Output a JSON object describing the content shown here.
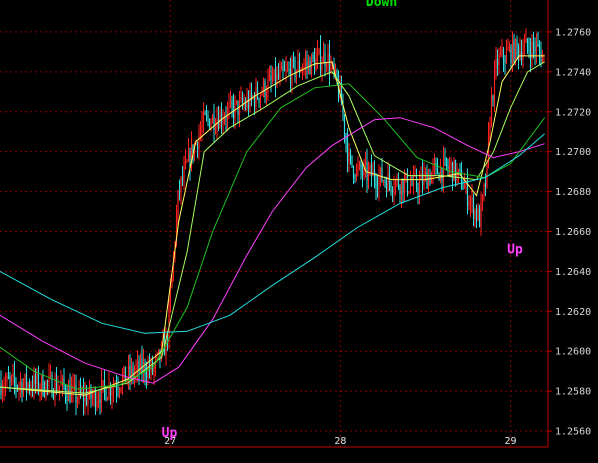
{
  "chart_data": {
    "type": "candlestick",
    "title": "",
    "xlabel": "",
    "ylabel": "",
    "ylim": [
      1.2552,
      1.2776
    ],
    "y_ticks": [
      "1.2560",
      "1.2580",
      "1.2600",
      "1.2620",
      "1.2640",
      "1.2660",
      "1.2680",
      "1.2700",
      "1.2720",
      "1.2740",
      "1.2760"
    ],
    "x_ticks": [
      "27",
      "28",
      "29"
    ],
    "grid": true,
    "colors": {
      "background": "#000000",
      "grid": "#8b0000",
      "axis": "#c00000",
      "up_candle": "#ff2020",
      "down_candle": "#30e0e0",
      "ma_fast": "#ffff60",
      "ma_mid": "#a8ff60",
      "ma_slow": "#20c020",
      "ma_long": "#ff40ff",
      "ma_longest": "#20e0e0",
      "signal_down": "#00e000",
      "signal_up": "#ff40ff"
    },
    "annotations": [
      {
        "text": "Down",
        "at": 28.15,
        "value": 1.2773,
        "color": "#00e000"
      },
      {
        "text": "Up",
        "at": 26.95,
        "value": 1.2557,
        "color": "#ff40ff"
      },
      {
        "text": "Up",
        "at": 28.98,
        "value": 1.2649,
        "color": "#ff40ff"
      }
    ],
    "price_path": [
      [
        26.0,
        1.2584
      ],
      [
        26.35,
        1.2583
      ],
      [
        26.45,
        1.2577
      ],
      [
        26.55,
        1.2577
      ],
      [
        26.7,
        1.2585
      ],
      [
        26.85,
        1.2592
      ],
      [
        26.9,
        1.259
      ],
      [
        26.98,
        1.2605
      ],
      [
        27.05,
        1.268
      ],
      [
        27.12,
        1.2698
      ],
      [
        27.2,
        1.2715
      ],
      [
        27.3,
        1.2718
      ],
      [
        27.45,
        1.2724
      ],
      [
        27.6,
        1.2735
      ],
      [
        27.75,
        1.2742
      ],
      [
        27.85,
        1.2745
      ],
      [
        27.92,
        1.2748
      ],
      [
        28.0,
        1.2728
      ],
      [
        28.05,
        1.2695
      ],
      [
        28.1,
        1.269
      ],
      [
        28.2,
        1.2688
      ],
      [
        28.3,
        1.2685
      ],
      [
        28.45,
        1.2683
      ],
      [
        28.55,
        1.269
      ],
      [
        28.65,
        1.2692
      ],
      [
        28.72,
        1.2684
      ],
      [
        28.78,
        1.2672
      ],
      [
        28.82,
        1.2666
      ],
      [
        28.86,
        1.2688
      ],
      [
        28.88,
        1.272
      ],
      [
        28.92,
        1.2745
      ],
      [
        29.0,
        1.275
      ],
      [
        29.08,
        1.2752
      ],
      [
        29.15,
        1.2752
      ],
      [
        29.2,
        1.2746
      ]
    ],
    "series": [
      {
        "key": "ma_fast",
        "points": [
          [
            26.0,
            1.2582
          ],
          [
            26.5,
            1.2578
          ],
          [
            26.75,
            1.2586
          ],
          [
            26.95,
            1.26
          ],
          [
            27.05,
            1.2665
          ],
          [
            27.15,
            1.2705
          ],
          [
            27.3,
            1.2716
          ],
          [
            27.5,
            1.2728
          ],
          [
            27.7,
            1.2738
          ],
          [
            27.85,
            1.2744
          ],
          [
            27.95,
            1.2745
          ],
          [
            28.05,
            1.2712
          ],
          [
            28.15,
            1.269
          ],
          [
            28.3,
            1.2686
          ],
          [
            28.5,
            1.2686
          ],
          [
            28.7,
            1.2689
          ],
          [
            28.8,
            1.2678
          ],
          [
            28.88,
            1.2705
          ],
          [
            28.95,
            1.2735
          ],
          [
            29.05,
            1.2748
          ],
          [
            29.2,
            1.2748
          ]
        ]
      },
      {
        "key": "ma_mid",
        "points": [
          [
            26.0,
            1.2582
          ],
          [
            26.5,
            1.2579
          ],
          [
            26.75,
            1.2584
          ],
          [
            26.95,
            1.2597
          ],
          [
            27.1,
            1.265
          ],
          [
            27.2,
            1.27
          ],
          [
            27.35,
            1.2712
          ],
          [
            27.55,
            1.2722
          ],
          [
            27.75,
            1.2733
          ],
          [
            27.95,
            1.274
          ],
          [
            28.05,
            1.2728
          ],
          [
            28.2,
            1.2698
          ],
          [
            28.4,
            1.2688
          ],
          [
            28.6,
            1.2688
          ],
          [
            28.8,
            1.2686
          ],
          [
            28.9,
            1.27
          ],
          [
            29.0,
            1.2722
          ],
          [
            29.1,
            1.274
          ],
          [
            29.2,
            1.2745
          ]
        ]
      },
      {
        "key": "ma_slow",
        "points": [
          [
            26.0,
            1.2602
          ],
          [
            26.2,
            1.259
          ],
          [
            26.45,
            1.2581
          ],
          [
            26.7,
            1.2583
          ],
          [
            26.9,
            1.2592
          ],
          [
            27.1,
            1.2622
          ],
          [
            27.25,
            1.266
          ],
          [
            27.45,
            1.27
          ],
          [
            27.65,
            1.2722
          ],
          [
            27.85,
            1.2732
          ],
          [
            28.05,
            1.2734
          ],
          [
            28.25,
            1.2717
          ],
          [
            28.45,
            1.2697
          ],
          [
            28.65,
            1.269
          ],
          [
            28.85,
            1.2687
          ],
          [
            29.0,
            1.2694
          ],
          [
            29.2,
            1.2717
          ]
        ]
      },
      {
        "key": "ma_long",
        "points": [
          [
            26.0,
            1.2618
          ],
          [
            26.25,
            1.2605
          ],
          [
            26.5,
            1.2594
          ],
          [
            26.75,
            1.2587
          ],
          [
            26.9,
            1.2584
          ],
          [
            27.05,
            1.2592
          ],
          [
            27.25,
            1.2616
          ],
          [
            27.45,
            1.2648
          ],
          [
            27.6,
            1.267
          ],
          [
            27.8,
            1.2692
          ],
          [
            27.95,
            1.2703
          ],
          [
            28.2,
            1.2716
          ],
          [
            28.35,
            1.2717
          ],
          [
            28.55,
            1.2712
          ],
          [
            28.75,
            1.2703
          ],
          [
            28.9,
            1.2697
          ],
          [
            29.05,
            1.27
          ],
          [
            29.2,
            1.2704
          ]
        ]
      },
      {
        "key": "ma_longest",
        "points": [
          [
            26.0,
            1.264
          ],
          [
            26.3,
            1.2626
          ],
          [
            26.6,
            1.2614
          ],
          [
            26.85,
            1.2609
          ],
          [
            27.1,
            1.261
          ],
          [
            27.35,
            1.2618
          ],
          [
            27.6,
            1.2633
          ],
          [
            27.85,
            1.2647
          ],
          [
            28.1,
            1.2662
          ],
          [
            28.35,
            1.2674
          ],
          [
            28.6,
            1.2682
          ],
          [
            28.85,
            1.2687
          ],
          [
            29.05,
            1.2698
          ],
          [
            29.2,
            1.2709
          ]
        ]
      }
    ]
  }
}
